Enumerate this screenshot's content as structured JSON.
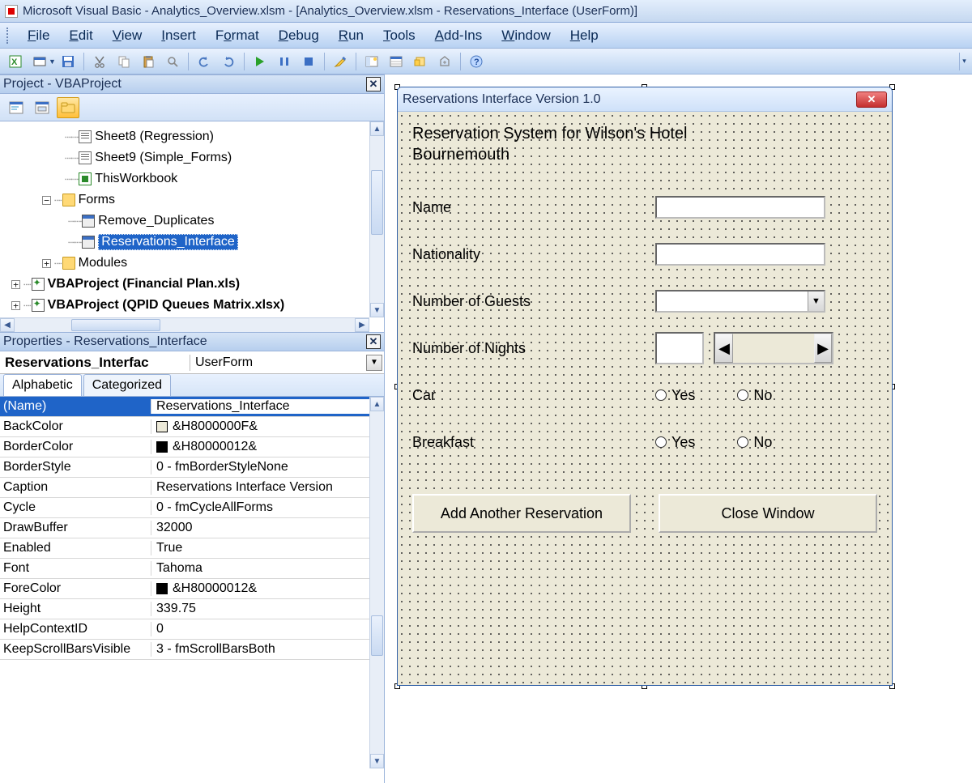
{
  "title": "Microsoft Visual Basic - Analytics_Overview.xlsm - [Analytics_Overview.xlsm - Reservations_Interface (UserForm)]",
  "menus": {
    "file": {
      "u": "F",
      "rest": "ile"
    },
    "edit": {
      "u": "E",
      "rest": "dit"
    },
    "view": {
      "u": "V",
      "rest": "iew"
    },
    "insert": {
      "u": "I",
      "rest": "nsert"
    },
    "format": {
      "u": "o",
      "pre": "F",
      "rest": "rmat"
    },
    "debug": {
      "u": "D",
      "rest": "ebug"
    },
    "run": {
      "u": "R",
      "rest": "un"
    },
    "tools": {
      "u": "T",
      "rest": "ools"
    },
    "addins": {
      "u": "A",
      "rest": "dd-Ins"
    },
    "window": {
      "u": "W",
      "rest": "indow"
    },
    "help": {
      "u": "H",
      "rest": "elp"
    }
  },
  "project_panel": {
    "title": "Project - VBAProject",
    "nodes": {
      "sheet8": "Sheet8 (Regression)",
      "sheet9": "Sheet9 (Simple_Forms)",
      "thiswb": "ThisWorkbook",
      "forms": "Forms",
      "rd": "Remove_Duplicates",
      "ri": "Reservations_Interface",
      "modules": "Modules",
      "vbp1": "VBAProject (Financial Plan.xls)",
      "vbp2": "VBAProject (QPID Queues Matrix.xlsx)"
    }
  },
  "props_panel": {
    "title": "Properties - Reservations_Interface",
    "object_name": "Reservations_Interfac",
    "object_type": "UserForm",
    "tabs": {
      "a": "Alphabetic",
      "c": "Categorized"
    },
    "rows": [
      {
        "k": "(Name)",
        "v": "Reservations_Interface",
        "namerow": true
      },
      {
        "k": "BackColor",
        "v": "&H8000000F&",
        "swatch": "#ece9d8"
      },
      {
        "k": "BorderColor",
        "v": "&H80000012&",
        "swatch": "#000000"
      },
      {
        "k": "BorderStyle",
        "v": "0 - fmBorderStyleNone"
      },
      {
        "k": "Caption",
        "v": "Reservations Interface Version"
      },
      {
        "k": "Cycle",
        "v": "0 - fmCycleAllForms"
      },
      {
        "k": "DrawBuffer",
        "v": "32000"
      },
      {
        "k": "Enabled",
        "v": "True"
      },
      {
        "k": "Font",
        "v": "Tahoma"
      },
      {
        "k": "ForeColor",
        "v": "&H80000012&",
        "swatch": "#000000"
      },
      {
        "k": "Height",
        "v": "339.75"
      },
      {
        "k": "HelpContextID",
        "v": "0"
      },
      {
        "k": "KeepScrollBarsVisible",
        "v": "3 - fmScrollBarsBoth"
      }
    ]
  },
  "form": {
    "caption": "Reservations Interface Version 1.0",
    "heading_l1": "Reservation System for Wilson's Hotel",
    "heading_l2": "Bournemouth",
    "labels": {
      "name": "Name",
      "nationality": "Nationality",
      "guests": "Number of Guests",
      "nights": "Number of Nights",
      "car": "Car",
      "breakfast": "Breakfast"
    },
    "opts": {
      "yes": "Yes",
      "no": "No"
    },
    "buttons": {
      "add": "Add Another Reservation",
      "close": "Close Window"
    }
  }
}
